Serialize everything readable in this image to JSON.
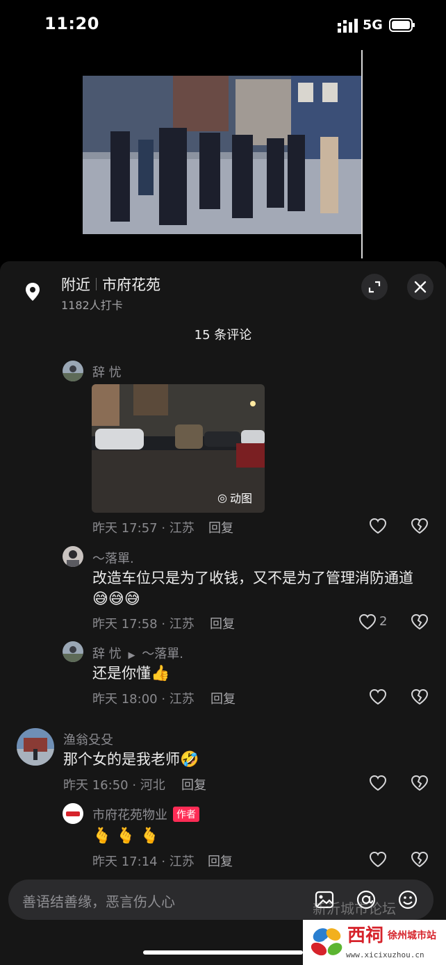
{
  "status": {
    "time": "11:20",
    "network": "5G"
  },
  "location": {
    "label": "附近",
    "place": "市府花苑",
    "checkins": "1182人打卡"
  },
  "comments_header": "15 条评论",
  "comments": [
    {
      "user": "辞 忧",
      "gif_label": "动图",
      "time_place": "昨天 17:57 · 江苏",
      "reply": "回复",
      "likes": ""
    },
    {
      "user": "～落單.",
      "text": "改造车位只是为了收钱，又不是为了管理消防通道",
      "emoji": "😅😅😅",
      "time_place": "昨天 17:58 · 江苏",
      "reply": "回复",
      "likes": "2"
    },
    {
      "user": "辞 忧",
      "reply_to": "～落單.",
      "text": "还是你懂",
      "emoji": "👍",
      "time_place": "昨天 18:00 · 江苏",
      "reply": "回复"
    },
    {
      "user": "渔翁殳殳",
      "text": "那个女的是我老师",
      "emoji": "🤣",
      "time_place": "昨天 16:50 · 河北",
      "reply": "回复"
    },
    {
      "user": "市府花苑物业",
      "badge": "作者",
      "emoji": "🫰 🫰 🫰",
      "time_place": "昨天 17:14 · 江苏",
      "reply": "回复"
    }
  ],
  "input": {
    "placeholder": "善语结善缘，恶言伤人心"
  },
  "watermark": "新沂城市论坛",
  "logo": {
    "name": "西祠",
    "sub": "徐州城市站",
    "url": "www.xicixuzhou.cn"
  },
  "icons": {
    "location": "map-pin-icon",
    "expand": "expand-icon",
    "close": "close-icon",
    "like": "heart-icon",
    "dislike": "broken-heart-icon",
    "image": "image-icon",
    "mention": "at-icon",
    "emoji": "smile-icon"
  }
}
